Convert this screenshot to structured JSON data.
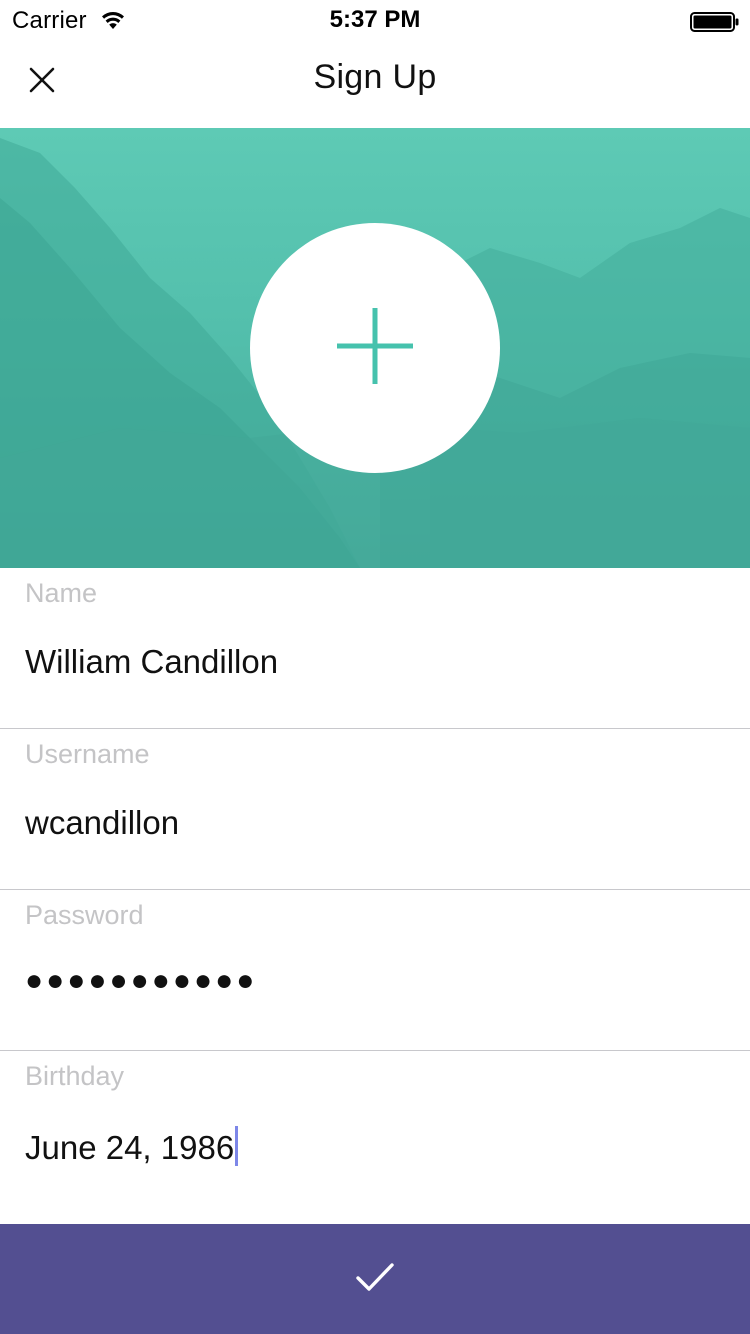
{
  "status_bar": {
    "carrier": "Carrier",
    "time": "5:37 PM",
    "wifi_icon": "wifi-icon",
    "battery_icon": "battery-full-icon"
  },
  "nav": {
    "title": "Sign Up",
    "close_icon": "close-icon"
  },
  "header": {
    "avatar_icon": "plus-icon",
    "accent_color": "#46c2ad",
    "banner_color": "#55c0ad"
  },
  "form": {
    "fields": [
      {
        "label": "Name",
        "value": "William Candillon"
      },
      {
        "label": "Username",
        "value": "wcandillon"
      },
      {
        "label": "Password",
        "value": "●●●●●●●●●●●"
      },
      {
        "label": "Birthday",
        "value": "June 24, 1986"
      }
    ]
  },
  "submit": {
    "icon": "checkmark-icon",
    "color": "#534f91"
  }
}
